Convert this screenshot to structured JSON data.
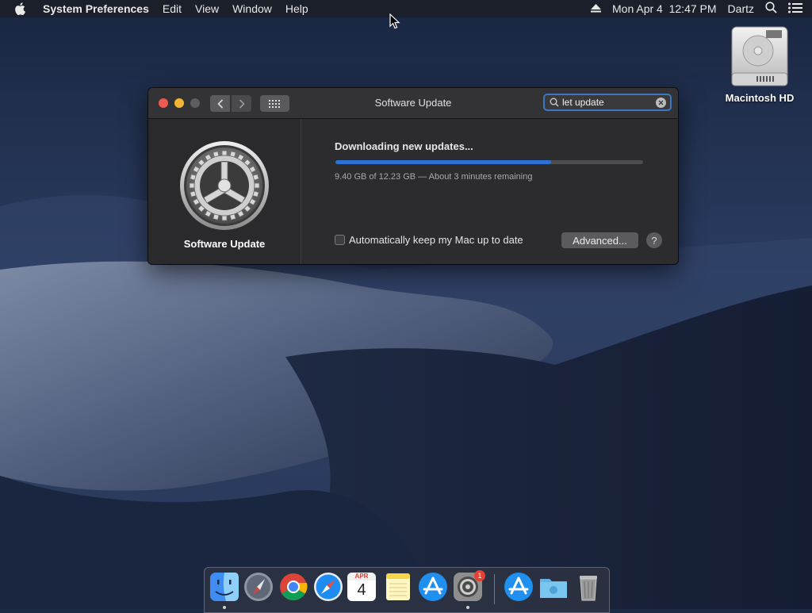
{
  "menubar": {
    "app_name": "System Preferences",
    "menus": [
      "Edit",
      "View",
      "Window",
      "Help"
    ],
    "datetime": "Mon Apr 4  12:47 PM",
    "user": "Dartz"
  },
  "desktop": {
    "disk_label": "Macintosh HD"
  },
  "window": {
    "title": "Software Update",
    "search_value": "let update",
    "sidebar_label": "Software Update",
    "status": "Downloading new updates...",
    "progress_fraction": 0.7,
    "detail": "9.40 GB of 12.23 GB — About 3 minutes remaining",
    "auto_update_label": "Automatically keep my Mac up to date",
    "auto_update_checked": false,
    "advanced_label": "Advanced...",
    "help_label": "?"
  },
  "dock": {
    "calendar_month": "APR",
    "calendar_day": "4",
    "badge": "1"
  },
  "colors": {
    "accent": "#2a72d8",
    "close": "#ee5a52",
    "minimize": "#f4b631"
  }
}
